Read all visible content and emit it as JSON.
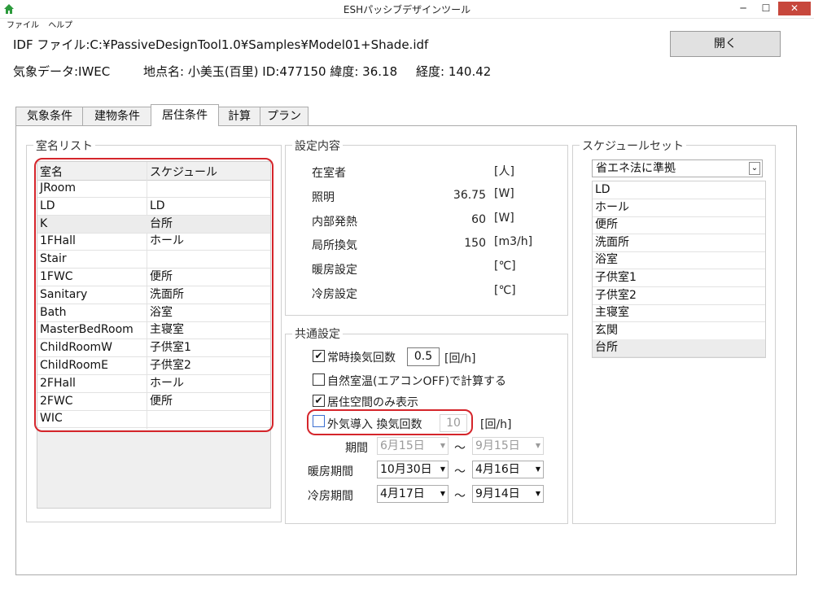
{
  "window": {
    "title": "ESHパッシブデザインツール"
  },
  "menu": [
    "ファイル",
    "ヘルプ"
  ],
  "file": {
    "idf_label": "IDF ファイル:C:¥PassiveDesignTool1.0¥Samples¥Model01+Shade.idf",
    "open_button": "開く"
  },
  "weather": {
    "data_label": "気象データ:IWEC",
    "location": "地点名: 小美玉(百里) ID:477150  緯度: 36.18",
    "longitude": "経度: 140.42"
  },
  "tabs": [
    "気象条件",
    "建物条件",
    "居住条件",
    "計算",
    "プラン"
  ],
  "active_tab": 2,
  "room_list": {
    "legend": "室名リスト",
    "headers": [
      "室名",
      "スケジュール"
    ],
    "rows": [
      [
        "JRoom",
        ""
      ],
      [
        "LD",
        "LD"
      ],
      [
        "K",
        "台所"
      ],
      [
        "1FHall",
        "ホール"
      ],
      [
        "Stair",
        ""
      ],
      [
        "1FWC",
        "便所"
      ],
      [
        "Sanitary",
        "洗面所"
      ],
      [
        "Bath",
        "浴室"
      ],
      [
        "MasterBedRoom",
        "主寝室"
      ],
      [
        "ChildRoomW",
        "子供室1"
      ],
      [
        "ChildRoomE",
        "子供室2"
      ],
      [
        "2FHall",
        "ホール"
      ],
      [
        "2FWC",
        "便所"
      ],
      [
        "WIC",
        ""
      ]
    ],
    "selected_row": 2
  },
  "settings": {
    "legend": "設定内容",
    "items": [
      {
        "label": "在室者",
        "value": "",
        "unit": "[人]"
      },
      {
        "label": "照明",
        "value": "36.75",
        "unit": "[W]"
      },
      {
        "label": "内部発熱",
        "value": "60",
        "unit": "[W]"
      },
      {
        "label": "局所換気",
        "value": "150",
        "unit": "[m3/h]"
      },
      {
        "label": "暖房設定",
        "value": "",
        "unit": "[℃]"
      },
      {
        "label": "冷房設定",
        "value": "",
        "unit": "[℃]"
      }
    ]
  },
  "common": {
    "legend": "共通設定",
    "ventilation": {
      "label": "常時換気回数",
      "value": "0.5",
      "unit": "[回/h]",
      "checked": "✔"
    },
    "natural_temp": {
      "label": "自然室温(エアコンOFF)で計算する",
      "checked": ""
    },
    "living_only": {
      "label": "居住空間のみ表示",
      "checked": "✔"
    },
    "outdoor_air": {
      "label": "外気導入  換気回数",
      "value": "10",
      "unit": "[回/h]",
      "checked": ""
    },
    "period": {
      "label": "期間",
      "from": "6月15日",
      "to": "9月15日"
    },
    "heating": {
      "label": "暖房期間",
      "from": "10月30日",
      "to": "4月16日"
    },
    "cooling": {
      "label": "冷房期間",
      "from": "4月17日",
      "to": "9月14日"
    },
    "tilde": "〜"
  },
  "schedule_set": {
    "legend": "スケジュールセット",
    "selected": "省エネ法に準拠",
    "items": [
      "LD",
      "ホール",
      "便所",
      "洗面所",
      "浴室",
      "子供室1",
      "子供室2",
      "主寝室",
      "玄関",
      "台所"
    ],
    "selected_item": 9
  },
  "colors": {
    "highlight": "#d5252b",
    "selected_row": "#ececec"
  }
}
